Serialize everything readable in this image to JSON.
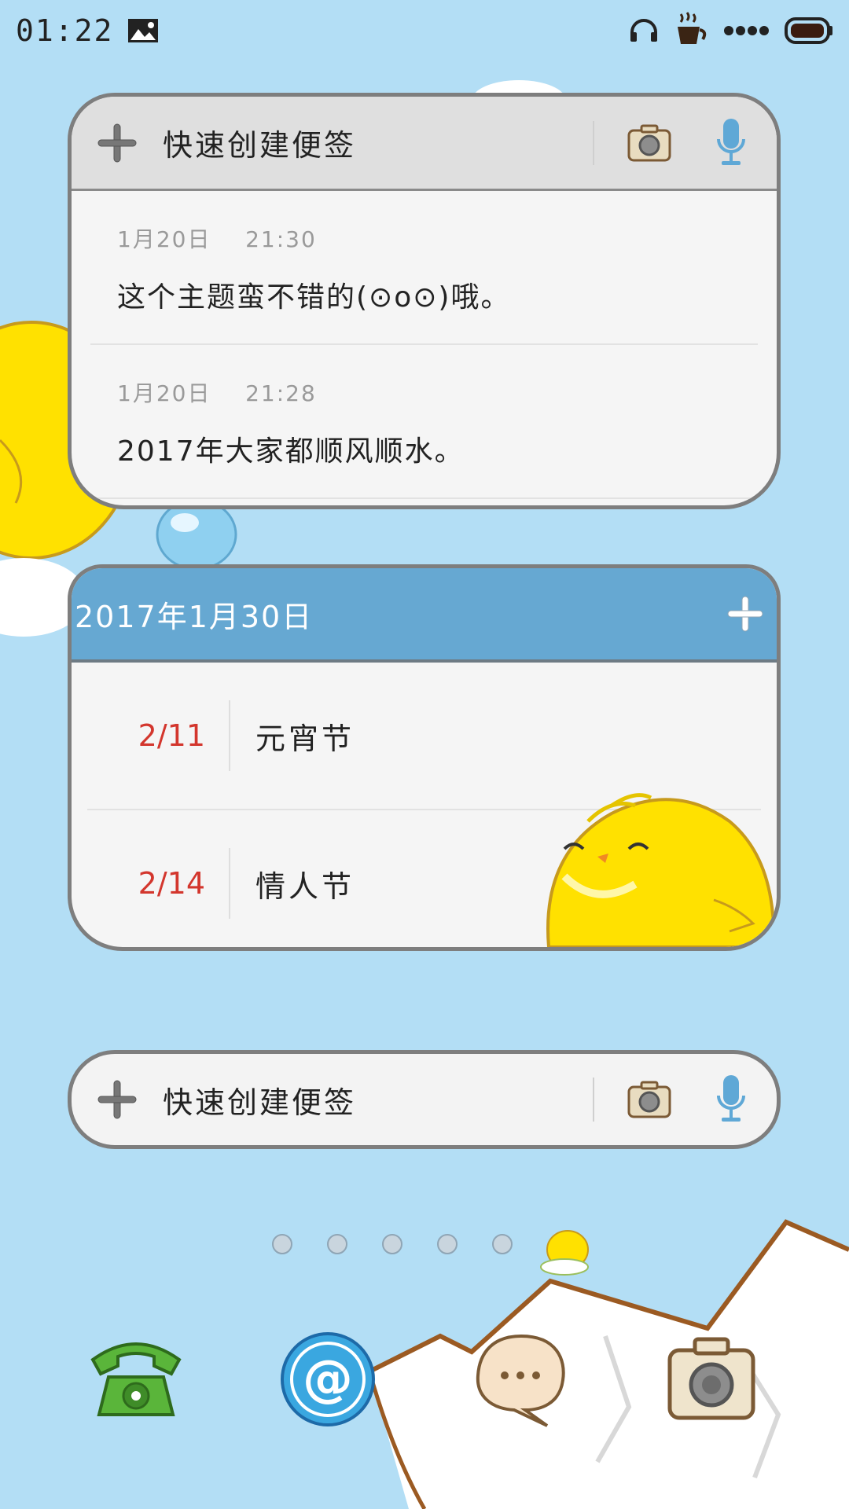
{
  "status_bar": {
    "time": "01:22",
    "icons": [
      "image-icon",
      "headphones-icon",
      "coffee-cup-icon",
      "signal-dots-icon",
      "battery-icon"
    ]
  },
  "note_widget_top": {
    "create_label": "快速创建便签",
    "notes": [
      {
        "date": "1月20日",
        "time": "21:30",
        "text": "这个主题蛮不错的(⊙o⊙)哦。"
      },
      {
        "date": "1月20日",
        "time": "21:28",
        "text": "2017年大家都顺风顺水。"
      }
    ]
  },
  "calendar_widget": {
    "title": "2017年1月30日",
    "events": [
      {
        "date": "2/11",
        "name": "元宵节"
      },
      {
        "date": "2/14",
        "name": "情人节"
      }
    ],
    "date_color": "#d3362d",
    "header_color": "#66a8d2"
  },
  "note_widget_bottom": {
    "create_label": "快速创建便签"
  },
  "pager": {
    "pages": 6,
    "current_page": 6
  },
  "dock": {
    "apps": [
      "phone-icon",
      "at-mail-icon",
      "message-bubble-icon",
      "camera-icon"
    ]
  },
  "colors": {
    "sky": "#b3def5",
    "chick_yellow": "#ffe100",
    "widget_border": "#7e7e7e"
  }
}
